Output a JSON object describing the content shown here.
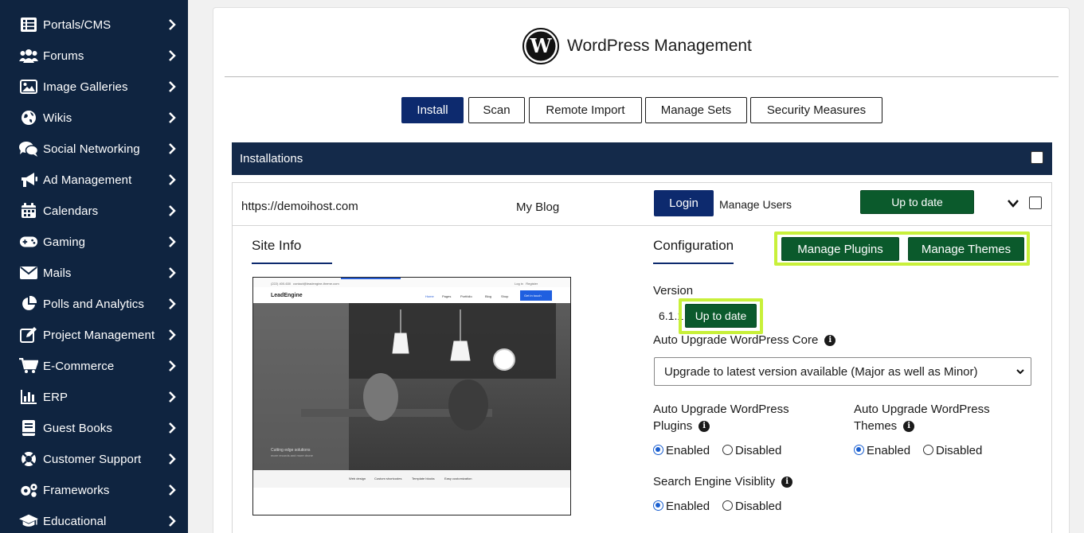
{
  "sidebar": {
    "items": [
      {
        "label": "Portals/CMS",
        "icon": "list-icon"
      },
      {
        "label": "Forums",
        "icon": "users-icon"
      },
      {
        "label": "Image Galleries",
        "icon": "image-icon"
      },
      {
        "label": "Wikis",
        "icon": "globe-icon"
      },
      {
        "label": "Social Networking",
        "icon": "chat-icon"
      },
      {
        "label": "Ad Management",
        "icon": "megaphone-icon"
      },
      {
        "label": "Calendars",
        "icon": "calendar-icon"
      },
      {
        "label": "Gaming",
        "icon": "gamepad-icon"
      },
      {
        "label": "Mails",
        "icon": "envelope-icon"
      },
      {
        "label": "Polls and Analytics",
        "icon": "pie-chart-icon"
      },
      {
        "label": "Project Management",
        "icon": "edit-icon"
      },
      {
        "label": "E-Commerce",
        "icon": "cart-icon"
      },
      {
        "label": "ERP",
        "icon": "bar-chart-icon"
      },
      {
        "label": "Guest Books",
        "icon": "book-icon"
      },
      {
        "label": "Customer Support",
        "icon": "lifebuoy-icon"
      },
      {
        "label": "Frameworks",
        "icon": "gears-icon"
      },
      {
        "label": "Educational",
        "icon": "graduation-cap-icon"
      }
    ]
  },
  "header": {
    "title": "WordPress Management"
  },
  "tabs": [
    "Install",
    "Scan",
    "Remote Import",
    "Manage Sets",
    "Security Measures"
  ],
  "installations": {
    "title": "Installations",
    "row": {
      "url": "https://demoihost.com",
      "site_name": "My Blog",
      "login_label": "Login",
      "manage_users_label": "Manage Users",
      "status_label": "Up to date"
    }
  },
  "site_info": {
    "title": "Site Info",
    "preview": {
      "topbar_phone": "(222) 400-630",
      "topbar_email": "contact@leadengine-theme.com",
      "topbar_links": "Log in   Register",
      "brand": "LeadEngine",
      "nav": [
        "Home",
        "Pages",
        "Portfolio",
        "Blog",
        "Shop"
      ],
      "cta": "Get in touch",
      "hero_line1": "Cutting edge solutions",
      "hero_line2": "more records and more drone",
      "features": [
        "Web design",
        "Custom shortcodes",
        "Template blocks",
        "Easy customization"
      ]
    }
  },
  "configuration": {
    "title": "Configuration",
    "manage_plugins_label": "Manage Plugins",
    "manage_themes_label": "Manage Themes",
    "version_label": "Version",
    "version_value": "6.1.1",
    "version_status": "Up to date",
    "auto_upgrade_core_label": "Auto Upgrade WordPress Core",
    "auto_upgrade_core_value": "Upgrade to latest version available (Major as well as Minor)",
    "auto_upgrade_plugins_label_line1": "Auto Upgrade WordPress",
    "auto_upgrade_plugins_label_line2": "Plugins",
    "auto_upgrade_themes_label_line1": "Auto Upgrade WordPress",
    "auto_upgrade_themes_label_line2": "Themes",
    "enabled_label": "Enabled",
    "disabled_label": "Disabled",
    "search_engine_label": "Search Engine Visiblity"
  }
}
